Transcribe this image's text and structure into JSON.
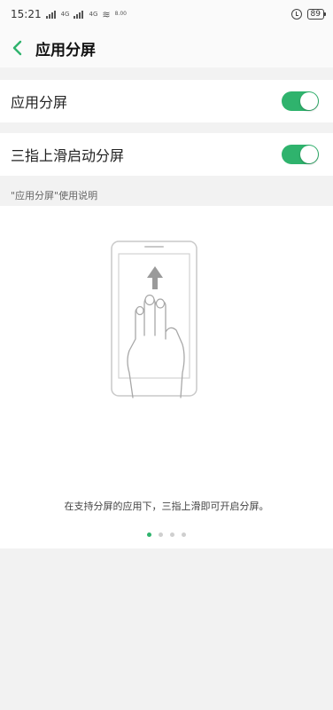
{
  "status_bar": {
    "time": "15:21",
    "signal1_label": "4G",
    "signal2_label": "4G",
    "net_speed": "8.00",
    "battery": "89"
  },
  "header": {
    "title": "应用分屏"
  },
  "settings": {
    "items": [
      {
        "label": "应用分屏",
        "enabled": true
      },
      {
        "label": "三指上滑启动分屏",
        "enabled": true
      }
    ]
  },
  "guide": {
    "caption": "\"应用分屏\"使用说明",
    "description": "在支持分屏的应用下，三指上滑即可开启分屏。",
    "pages": 4,
    "current_page": 1
  },
  "colors": {
    "accent": "#2fb36d",
    "background": "#f2f2f2"
  },
  "icons": {
    "back": "chevron-left-icon",
    "alarm": "alarm-icon",
    "wifi": "wifi-icon",
    "battery": "battery-icon",
    "illustration": "three-finger-swipe-up-illustration"
  }
}
